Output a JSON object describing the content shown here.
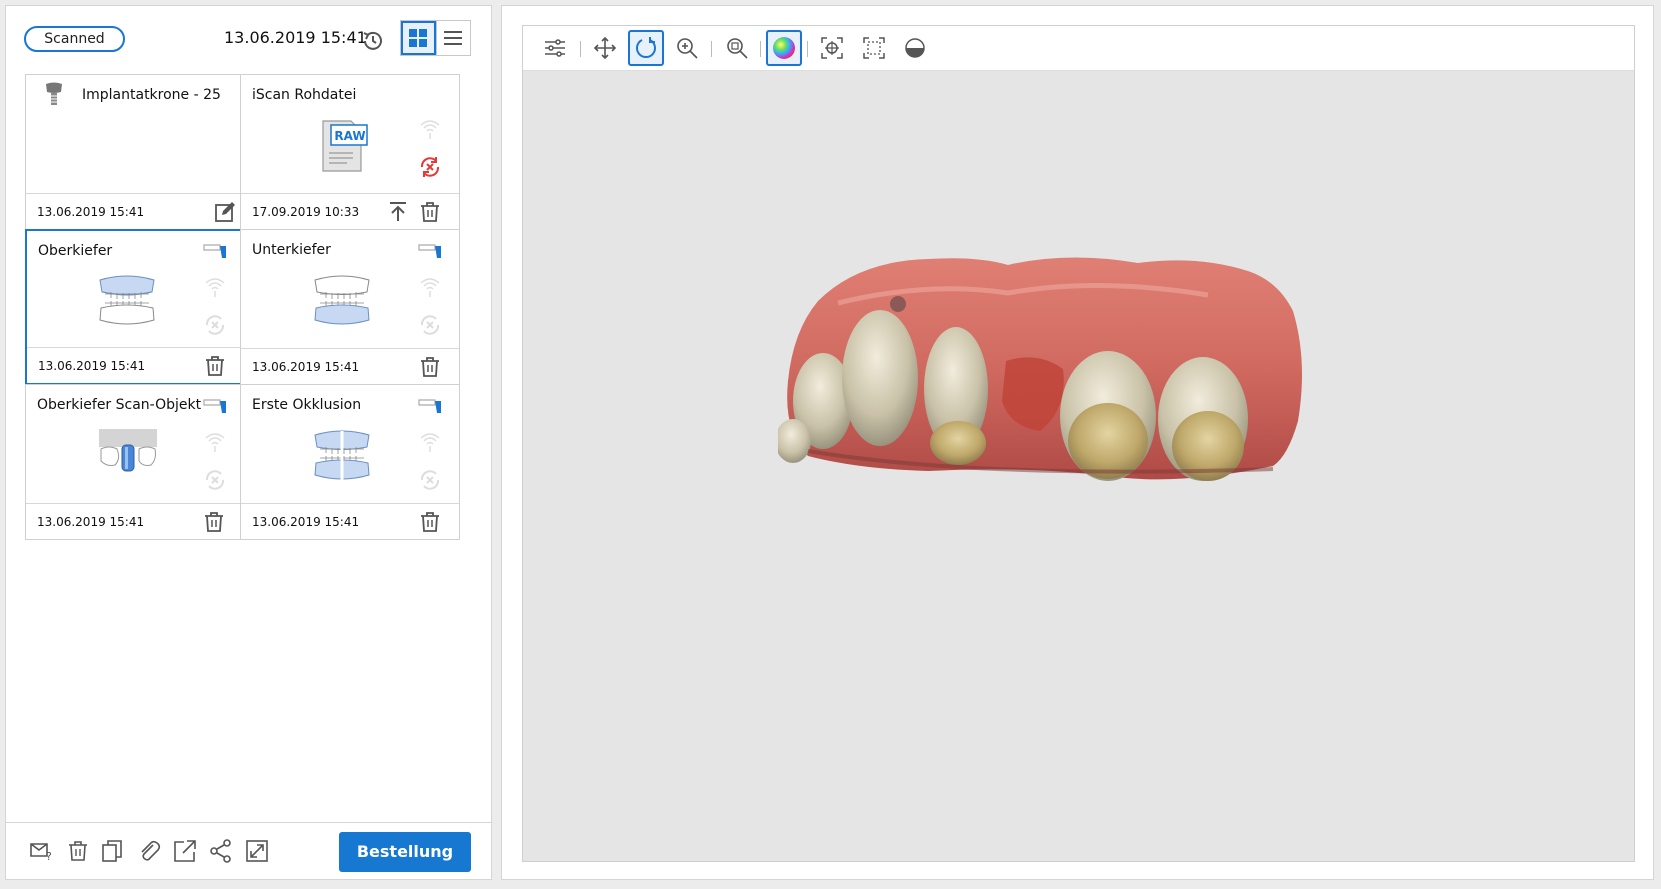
{
  "header": {
    "status": "Scanned",
    "datetime": "13.06.2019 15:41"
  },
  "cards": [
    {
      "title": "Implantatkrone - 25",
      "date": "13.06.2019 15:41"
    },
    {
      "title": "iScan Rohdatei",
      "date": "17.09.2019 10:33",
      "raw_label": "RAW"
    },
    {
      "title": "Oberkiefer",
      "date": "13.06.2019 15:41"
    },
    {
      "title": "Unterkiefer",
      "date": "13.06.2019 15:41"
    },
    {
      "title": "Oberkiefer Scan-Objekt",
      "date": "13.06.2019 15:41"
    },
    {
      "title": "Erste Okklusion",
      "date": "13.06.2019 15:41"
    }
  ],
  "footer": {
    "order_label": "Bestellung"
  },
  "colors": {
    "accent": "#1976d2",
    "button": "#1778d2",
    "sync_error": "#e53935",
    "viewport_bg": "#e5e5e5"
  },
  "icons": [
    "history-icon",
    "grid-view-icon",
    "list-view-icon",
    "tooth-implant-icon",
    "edit-icon",
    "upload-icon",
    "trash-icon",
    "wireless-icon",
    "sync-error-icon",
    "scanner-icon",
    "mail-help-icon",
    "copy-icon",
    "attach-icon",
    "export-icon",
    "share-icon",
    "expand-icon",
    "settings-sliders-icon",
    "pan-icon",
    "rotate-icon",
    "zoom-in-icon",
    "zoom-fit-icon",
    "color-texture-icon",
    "focus-target-icon",
    "select-region-icon",
    "half-circle-icon"
  ]
}
